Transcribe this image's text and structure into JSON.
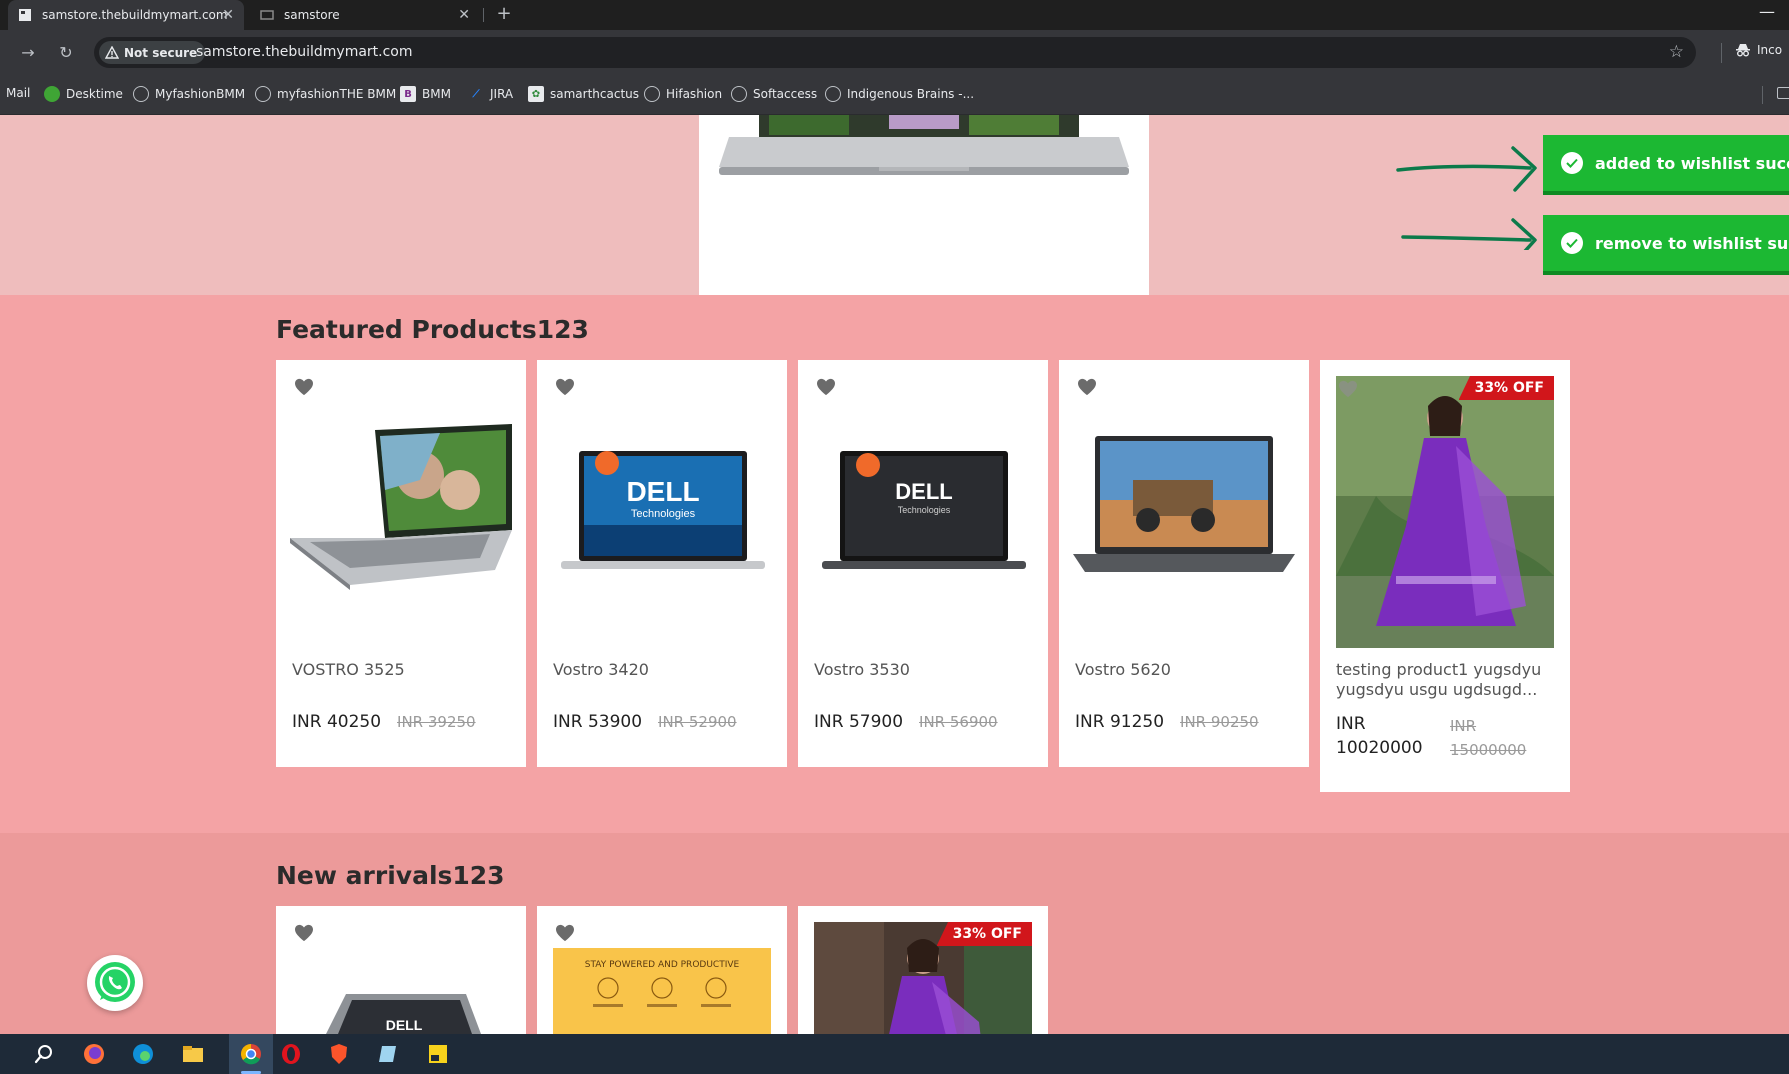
{
  "browser": {
    "tabs": [
      {
        "title": "samstore.thebuildmymart.com",
        "active": true
      },
      {
        "title": "samstore",
        "active": false
      }
    ],
    "security_label": "Not secure",
    "url": "samstore.thebuildmymart.com",
    "profile_label": "Inco",
    "bookmarks": [
      {
        "label": "Mail",
        "icon": "none"
      },
      {
        "label": "Desktime",
        "icon": "desktime-icon"
      },
      {
        "label": "MyfashionBMM",
        "icon": "globe-icon"
      },
      {
        "label": "myfashionTHE BMM",
        "icon": "globe-icon"
      },
      {
        "label": "BMM",
        "icon": "bmm-icon"
      },
      {
        "label": "JIRA",
        "icon": "jira-icon"
      },
      {
        "label": "samarthcactus",
        "icon": "cactus-icon"
      },
      {
        "label": "Hifashion",
        "icon": "globe-icon"
      },
      {
        "label": "Softaccess",
        "icon": "globe-icon"
      },
      {
        "label": "Indigenous Brains -...",
        "icon": "globe-icon"
      }
    ]
  },
  "toasts": [
    {
      "message": "added to wishlist successfully"
    },
    {
      "message": "remove to wishlist successfully"
    }
  ],
  "featured": {
    "title": "Featured Products123",
    "products": [
      {
        "name": "VOSTRO 3525",
        "price": "INR 40250",
        "mrp": "INR 39250",
        "image": "laptop-silver-couple"
      },
      {
        "name": "Vostro 3420",
        "price": "INR 53900",
        "mrp": "INR 52900",
        "image": "laptop-dell-blue"
      },
      {
        "name": "Vostro 3530",
        "price": "INR 57900",
        "mrp": "INR 56900",
        "image": "laptop-dell-dark"
      },
      {
        "name": "Vostro 5620",
        "price": "INR 91250",
        "mrp": "INR 90250",
        "image": "laptop-offroad"
      },
      {
        "name": "testing product1 yugsdyu yugsdyu usgu ugdsugd...",
        "price_prefix": "INR",
        "price_value": "10020000",
        "mrp_prefix": "INR",
        "mrp_value": "15000000",
        "badge": "33% OFF",
        "image": "purple-dress"
      }
    ]
  },
  "arrivals": {
    "title": "New arrivals123",
    "products": [
      {
        "image": "laptop-2in1"
      },
      {
        "image": "laptop-promo-yellow",
        "promo_text": "STAY POWERED AND PRODUCTIVE"
      },
      {
        "image": "purple-dress",
        "badge": "33% OFF"
      }
    ]
  },
  "colors": {
    "banner_band": "#efbdbd",
    "featured_band": "#f4a3a5",
    "arrivals_band": "#ec9a9a",
    "toast_green": "#1cb833",
    "arrow_green": "#0c7a4a",
    "badge_red": "#d1161b"
  }
}
